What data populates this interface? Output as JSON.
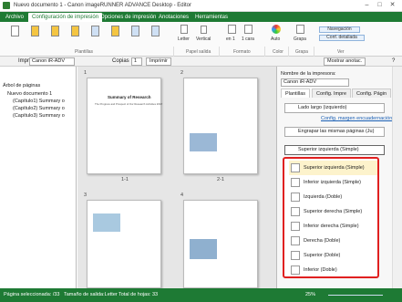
{
  "window": {
    "title": "Nuevo documento 1 - Canon imageRUNNER ADVANCE Desktop - Editor",
    "minimize": "–",
    "maximize": "□",
    "close": "✕"
  },
  "ribbon_tabs": [
    "Archivo",
    "Configuración de impresión",
    "Opciones de impresión",
    "Anotaciones",
    "Herramientas"
  ],
  "ribbon": {
    "groups": {
      "plantillas": "Plantillas",
      "papel_salida": "Papel salida",
      "formato": "Formato",
      "color": "Color",
      "grapa": "Grapa",
      "ver": "Ver"
    },
    "letter": "Letter",
    "vertical": "Vertical",
    "en1": "en 1",
    "una_cara": "1 cara",
    "auto": "Auto",
    "grapa": "Grapa",
    "navegacion": "Navegación",
    "conf_detallada": "Conf. detallada"
  },
  "toolbar": {
    "impr_label": "Impr",
    "printer": "Canon iR-ADV",
    "copias_label": "Copias",
    "copias": "1",
    "imprimir": "Imprimir",
    "mostrar_anotac": "Mostrar anotac.",
    "help": "?"
  },
  "tree": {
    "title": "Árbol de páginas",
    "root": "Nuevo documento 1",
    "items": [
      "(Capítulo1) Summary o",
      "(Capítulo2) Summary o",
      "(Capítulo3) Summary o"
    ]
  },
  "center": {
    "pages": [
      {
        "num": "1",
        "label": "1-1"
      },
      {
        "num": "2",
        "label": "2-1"
      },
      {
        "num": "3",
        "label": ""
      },
      {
        "num": "4",
        "label": ""
      }
    ],
    "page1_title": "Summary of Research",
    "page1_sub": "The Progress and Prospect of Our Research Activities 2018"
  },
  "right": {
    "printer_label": "Nombre de la impresora:",
    "printer": "Canon iR-ADV",
    "tabs": [
      "Plantillas",
      "Config. Impre",
      "Config. Págin"
    ],
    "binding": "Lado largo (izquierdo)",
    "binding_link": "Config. margen encuadernación",
    "stack": "Engrapar las mismas páginas (Ju)",
    "staple": "Superior izquierda (Simple)"
  },
  "dropdown": {
    "items": [
      "Superior izquierda (Simple)",
      "Inferior izquierda (Simple)",
      "Izquierda (Doble)",
      "Superior derecha (Simple)",
      "Inferior derecha (Simple)",
      "Derecha (Doble)",
      "Superior (Doble)",
      "Inferior (Doble)"
    ],
    "selected": 0
  },
  "status": {
    "selected_pages": "Página seleccionada: /33",
    "output_size": "Tamaño de salida:Letter",
    "total": "Total de hojas: 33",
    "zoom": "25%"
  },
  "colors": {
    "brand": "#1e7a34",
    "highlight": "#e02020",
    "selected_item": "#fdf3cc"
  }
}
